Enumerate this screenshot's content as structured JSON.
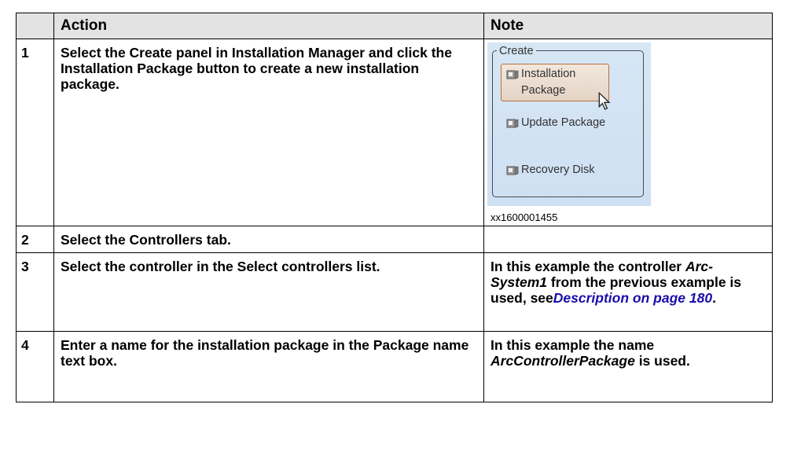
{
  "header": {
    "col_empty": "",
    "col_action": "Action",
    "col_note": "Note"
  },
  "rows": [
    {
      "num": "1",
      "action": {
        "p1": "Select the ",
        "b1": "Create",
        "p2": " panel in Installation Manager and click the ",
        "b2": "Installation Package",
        "p3": " button to create a new installation package."
      },
      "note": {
        "panel_title": "Create",
        "items": [
          "Installation",
          "Package",
          "Update Package",
          "Recovery Disk"
        ],
        "caption": "xx1600001455"
      }
    },
    {
      "num": "2",
      "action": {
        "p1": "Select the ",
        "b1": "Controllers",
        "p2": " tab."
      },
      "note": {}
    },
    {
      "num": "3",
      "action": {
        "p1": "Select the controller in the ",
        "b1": "Select controllers",
        "p2": " list."
      },
      "note": {
        "p1": "In this example the controller ",
        "i1": "Arc-System1",
        "p2": " from the previous example is used, see",
        "link": "Description on page 180",
        "p3": "."
      }
    },
    {
      "num": "4",
      "action": {
        "p1": "Enter a name for the installation package in the ",
        "b1": "Package name",
        "p2": " text box."
      },
      "note": {
        "p1": "In this example the name ",
        "i1": "ArcControllerPackage",
        "p2": " is used."
      }
    }
  ]
}
